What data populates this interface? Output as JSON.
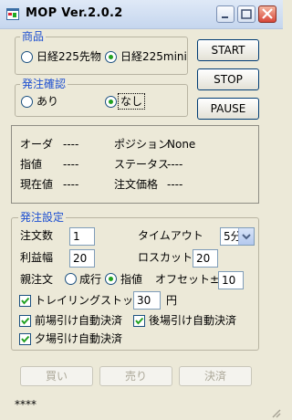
{
  "window": {
    "title": "MOP   Ver.2.0.2"
  },
  "product_group": {
    "legend": "商品",
    "options": [
      {
        "label": "日経225先物",
        "selected": false
      },
      {
        "label": "日経225mini",
        "selected": true
      }
    ]
  },
  "order_confirm_group": {
    "legend": "発注確認",
    "options": [
      {
        "label": "あり",
        "selected": false
      },
      {
        "label": "なし",
        "selected": true
      }
    ]
  },
  "controls": {
    "start_label": "START",
    "stop_label": "STOP",
    "pause_label": "PAUSE"
  },
  "status_panel": {
    "order_label": "オーダ",
    "order_value": "----",
    "position_label": "ポジション",
    "position_value": "None",
    "limit_label": "指値",
    "limit_value": "----",
    "status_label": "ステータス",
    "status_value": "----",
    "current_label": "現在値",
    "current_value": "----",
    "order_price_label": "注文価格",
    "order_price_value": "----"
  },
  "settings": {
    "legend": "発注設定",
    "quantity_label": "注文数",
    "quantity_value": "1",
    "timeout_label": "タイムアウト",
    "timeout_value": "5分",
    "profit_label": "利益幅",
    "profit_value": "20",
    "losscut_label": "ロスカット",
    "losscut_value": "20",
    "parent_label": "親注文",
    "parent_options": [
      {
        "label": "成行",
        "selected": false
      },
      {
        "label": "指値",
        "selected": true
      }
    ],
    "offset_label": "オフセット±",
    "offset_value": "10",
    "trailing_label": "トレイリングストップ ±",
    "trailing_checked": true,
    "trailing_value": "30",
    "trailing_unit": "円",
    "morning_close_label": "前場引け自動決済",
    "morning_close_checked": true,
    "afternoon_close_label": "後場引け自動決済",
    "afternoon_close_checked": true,
    "evening_close_label": "夕場引け自動決済",
    "evening_close_checked": true
  },
  "actions": {
    "buy_label": "買い",
    "sell_label": "売り",
    "settle_label": "決済"
  },
  "status_bar": {
    "text": "****"
  }
}
